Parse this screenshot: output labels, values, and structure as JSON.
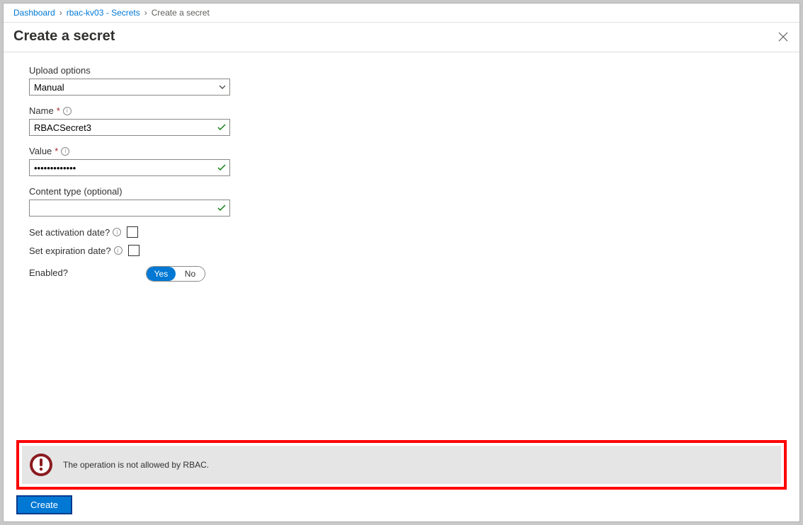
{
  "breadcrumb": {
    "items": [
      {
        "label": "Dashboard",
        "link": true
      },
      {
        "label": "rbac-kv03 - Secrets",
        "link": true
      },
      {
        "label": "Create a secret",
        "link": false
      }
    ]
  },
  "title": "Create a secret",
  "form": {
    "upload_options": {
      "label": "Upload options",
      "value": "Manual"
    },
    "name": {
      "label": "Name",
      "value": "RBACSecret3"
    },
    "value_field": {
      "label": "Value",
      "value": "•••••••••••••"
    },
    "content_type": {
      "label": "Content type (optional)",
      "value": ""
    },
    "activation": {
      "label": "Set activation date?"
    },
    "expiration": {
      "label": "Set expiration date?"
    },
    "enabled": {
      "label": "Enabled?",
      "yes": "Yes",
      "no": "No"
    }
  },
  "error": {
    "message": "The operation is not allowed by RBAC."
  },
  "buttons": {
    "create": "Create"
  }
}
